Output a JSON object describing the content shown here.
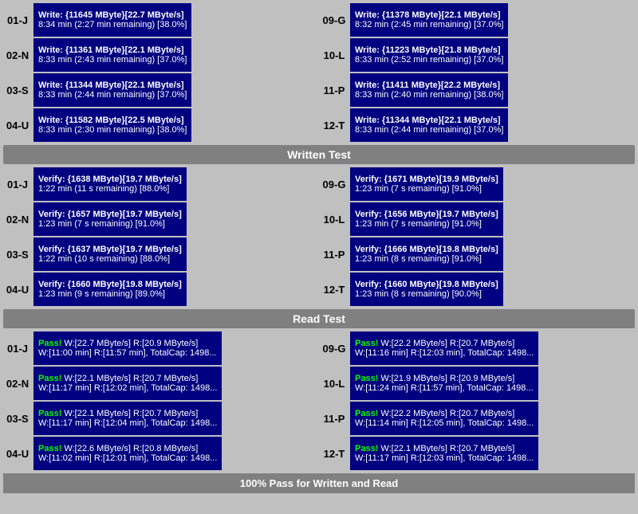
{
  "sections": {
    "written_test": {
      "label": "Written Test",
      "rows": [
        {
          "id": "01-J",
          "left": {
            "line1": "Write: {11645 MByte}[22.7 MByte/s]",
            "line2": "8:34 min (2:27 min remaining)  [38.0%]"
          }
        },
        {
          "id": "02-N",
          "left": {
            "line1": "Write: {11361 MByte}[22.1 MByte/s]",
            "line2": "8:33 min (2:43 min remaining)  [37.0%]"
          }
        },
        {
          "id": "03-S",
          "left": {
            "line1": "Write: {11344 MByte}[22.1 MByte/s]",
            "line2": "8:33 min (2:44 min remaining)  [37.0%]"
          }
        },
        {
          "id": "04-U",
          "left": {
            "line1": "Write: {11582 MByte}[22.5 MByte/s]",
            "line2": "8:33 min (2:30 min remaining)  [38.0%]"
          }
        }
      ],
      "right_rows": [
        {
          "id": "09-G",
          "line1": "Write: {11378 MByte}[22.1 MByte/s]",
          "line2": "8:32 min (2:45 min remaining)  [37.0%]"
        },
        {
          "id": "10-L",
          "line1": "Write: {11223 MByte}[21.8 MByte/s]",
          "line2": "8:33 min (2:52 min remaining)  [37.0%]"
        },
        {
          "id": "11-P",
          "line1": "Write: {11411 MByte}[22.2 MByte/s]",
          "line2": "8:33 min (2:40 min remaining)  [38.0%]"
        },
        {
          "id": "12-T",
          "line1": "Write: {11344 MByte}[22.1 MByte/s]",
          "line2": "8:33 min (2:44 min remaining)  [37.0%]"
        }
      ]
    },
    "verify_section": {
      "label": "Written Test",
      "left_rows": [
        {
          "id": "01-J",
          "line1": "Verify: {1638 MByte}[19.7 MByte/s]",
          "line2": "1:22 min (11 s remaining)   [88.0%]"
        },
        {
          "id": "02-N",
          "line1": "Verify: {1657 MByte}[19.7 MByte/s]",
          "line2": "1:23 min (7 s remaining)   [91.0%]"
        },
        {
          "id": "03-S",
          "line1": "Verify: {1637 MByte}[19.7 MByte/s]",
          "line2": "1:22 min (10 s remaining)   [88.0%]"
        },
        {
          "id": "04-U",
          "line1": "Verify: {1660 MByte}[19.8 MByte/s]",
          "line2": "1:23 min (9 s remaining)   [89.0%]"
        }
      ],
      "right_rows": [
        {
          "id": "09-G",
          "line1": "Verify: {1671 MByte}[19.9 MByte/s]",
          "line2": "1:23 min (7 s remaining)   [91.0%]"
        },
        {
          "id": "10-L",
          "line1": "Verify: {1656 MByte}[19.7 MByte/s]",
          "line2": "1:23 min (7 s remaining)   [91.0%]"
        },
        {
          "id": "11-P",
          "line1": "Verify: {1666 MByte}[19.8 MByte/s]",
          "line2": "1:23 min (8 s remaining)   [91.0%]"
        },
        {
          "id": "12-T",
          "line1": "Verify: {1660 MByte}[19.8 MByte/s]",
          "line2": "1:23 min (8 s remaining)   [90.0%]"
        }
      ]
    },
    "read_test": {
      "label": "Read Test",
      "left_rows": [
        {
          "id": "01-J",
          "line1": "Pass! W:[22.7 MByte/s] R:[20.9 MByte/s]",
          "line2": "W:[11:00 min] R:[11:57 min], TotalCap: 1498..."
        },
        {
          "id": "02-N",
          "line1": "Pass! W:[22.1 MByte/s] R:[20.7 MByte/s]",
          "line2": "W:[11:17 min] R:[12:02 min], TotalCap: 1498..."
        },
        {
          "id": "03-S",
          "line1": "Pass! W:[22.1 MByte/s] R:[20.7 MByte/s]",
          "line2": "W:[11:17 min] R:[12:04 min], TotalCap: 1498..."
        },
        {
          "id": "04-U",
          "line1": "Pass! W:[22.6 MByte/s] R:[20.8 MByte/s]",
          "line2": "W:[11:02 min] R:[12:01 min], TotalCap: 1498..."
        }
      ],
      "right_rows": [
        {
          "id": "09-G",
          "line1": "Pass! W:[22.2 MByte/s] R:[20.7 MByte/s]",
          "line2": "W:[11:16 min] R:[12:03 min], TotalCap: 1498..."
        },
        {
          "id": "10-L",
          "line1": "Pass! W:[21.9 MByte/s] R:[20.9 MByte/s]",
          "line2": "W:[11:24 min] R:[11:57 min], TotalCap: 1498..."
        },
        {
          "id": "11-P",
          "line1": "Pass! W:[22.2 MByte/s] R:[20.7 MByte/s]",
          "line2": "W:[11:14 min] R:[12:05 min], TotalCap: 1498..."
        },
        {
          "id": "12-T",
          "line1": "Pass! W:[22.1 MByte/s] R:[20.7 MByte/s]",
          "line2": "W:[11:17 min] R:[12:03 min], TotalCap: 1498..."
        }
      ]
    }
  },
  "footer": {
    "label": "100% Pass for Written and Read"
  }
}
